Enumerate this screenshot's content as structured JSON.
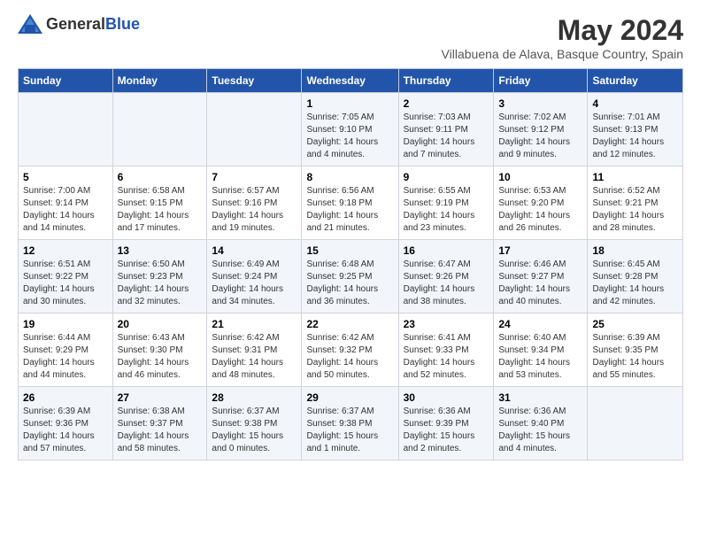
{
  "header": {
    "logo_general": "General",
    "logo_blue": "Blue",
    "title": "May 2024",
    "subtitle": "Villabuena de Alava, Basque Country, Spain"
  },
  "days_of_week": [
    "Sunday",
    "Monday",
    "Tuesday",
    "Wednesday",
    "Thursday",
    "Friday",
    "Saturday"
  ],
  "weeks": [
    [
      {
        "day": "",
        "sunrise": "",
        "sunset": "",
        "daylight": ""
      },
      {
        "day": "",
        "sunrise": "",
        "sunset": "",
        "daylight": ""
      },
      {
        "day": "",
        "sunrise": "",
        "sunset": "",
        "daylight": ""
      },
      {
        "day": "1",
        "sunrise": "7:05 AM",
        "sunset": "9:10 PM",
        "daylight": "14 hours and 4 minutes."
      },
      {
        "day": "2",
        "sunrise": "7:03 AM",
        "sunset": "9:11 PM",
        "daylight": "14 hours and 7 minutes."
      },
      {
        "day": "3",
        "sunrise": "7:02 AM",
        "sunset": "9:12 PM",
        "daylight": "14 hours and 9 minutes."
      },
      {
        "day": "4",
        "sunrise": "7:01 AM",
        "sunset": "9:13 PM",
        "daylight": "14 hours and 12 minutes."
      }
    ],
    [
      {
        "day": "5",
        "sunrise": "7:00 AM",
        "sunset": "9:14 PM",
        "daylight": "14 hours and 14 minutes."
      },
      {
        "day": "6",
        "sunrise": "6:58 AM",
        "sunset": "9:15 PM",
        "daylight": "14 hours and 17 minutes."
      },
      {
        "day": "7",
        "sunrise": "6:57 AM",
        "sunset": "9:16 PM",
        "daylight": "14 hours and 19 minutes."
      },
      {
        "day": "8",
        "sunrise": "6:56 AM",
        "sunset": "9:18 PM",
        "daylight": "14 hours and 21 minutes."
      },
      {
        "day": "9",
        "sunrise": "6:55 AM",
        "sunset": "9:19 PM",
        "daylight": "14 hours and 23 minutes."
      },
      {
        "day": "10",
        "sunrise": "6:53 AM",
        "sunset": "9:20 PM",
        "daylight": "14 hours and 26 minutes."
      },
      {
        "day": "11",
        "sunrise": "6:52 AM",
        "sunset": "9:21 PM",
        "daylight": "14 hours and 28 minutes."
      }
    ],
    [
      {
        "day": "12",
        "sunrise": "6:51 AM",
        "sunset": "9:22 PM",
        "daylight": "14 hours and 30 minutes."
      },
      {
        "day": "13",
        "sunrise": "6:50 AM",
        "sunset": "9:23 PM",
        "daylight": "14 hours and 32 minutes."
      },
      {
        "day": "14",
        "sunrise": "6:49 AM",
        "sunset": "9:24 PM",
        "daylight": "14 hours and 34 minutes."
      },
      {
        "day": "15",
        "sunrise": "6:48 AM",
        "sunset": "9:25 PM",
        "daylight": "14 hours and 36 minutes."
      },
      {
        "day": "16",
        "sunrise": "6:47 AM",
        "sunset": "9:26 PM",
        "daylight": "14 hours and 38 minutes."
      },
      {
        "day": "17",
        "sunrise": "6:46 AM",
        "sunset": "9:27 PM",
        "daylight": "14 hours and 40 minutes."
      },
      {
        "day": "18",
        "sunrise": "6:45 AM",
        "sunset": "9:28 PM",
        "daylight": "14 hours and 42 minutes."
      }
    ],
    [
      {
        "day": "19",
        "sunrise": "6:44 AM",
        "sunset": "9:29 PM",
        "daylight": "14 hours and 44 minutes."
      },
      {
        "day": "20",
        "sunrise": "6:43 AM",
        "sunset": "9:30 PM",
        "daylight": "14 hours and 46 minutes."
      },
      {
        "day": "21",
        "sunrise": "6:42 AM",
        "sunset": "9:31 PM",
        "daylight": "14 hours and 48 minutes."
      },
      {
        "day": "22",
        "sunrise": "6:42 AM",
        "sunset": "9:32 PM",
        "daylight": "14 hours and 50 minutes."
      },
      {
        "day": "23",
        "sunrise": "6:41 AM",
        "sunset": "9:33 PM",
        "daylight": "14 hours and 52 minutes."
      },
      {
        "day": "24",
        "sunrise": "6:40 AM",
        "sunset": "9:34 PM",
        "daylight": "14 hours and 53 minutes."
      },
      {
        "day": "25",
        "sunrise": "6:39 AM",
        "sunset": "9:35 PM",
        "daylight": "14 hours and 55 minutes."
      }
    ],
    [
      {
        "day": "26",
        "sunrise": "6:39 AM",
        "sunset": "9:36 PM",
        "daylight": "14 hours and 57 minutes."
      },
      {
        "day": "27",
        "sunrise": "6:38 AM",
        "sunset": "9:37 PM",
        "daylight": "14 hours and 58 minutes."
      },
      {
        "day": "28",
        "sunrise": "6:37 AM",
        "sunset": "9:38 PM",
        "daylight": "15 hours and 0 minutes."
      },
      {
        "day": "29",
        "sunrise": "6:37 AM",
        "sunset": "9:38 PM",
        "daylight": "15 hours and 1 minute."
      },
      {
        "day": "30",
        "sunrise": "6:36 AM",
        "sunset": "9:39 PM",
        "daylight": "15 hours and 2 minutes."
      },
      {
        "day": "31",
        "sunrise": "6:36 AM",
        "sunset": "9:40 PM",
        "daylight": "15 hours and 4 minutes."
      },
      {
        "day": "",
        "sunrise": "",
        "sunset": "",
        "daylight": ""
      }
    ]
  ],
  "labels": {
    "sunrise_prefix": "Sunrise: ",
    "sunset_prefix": "Sunset: ",
    "daylight_prefix": "Daylight: "
  }
}
